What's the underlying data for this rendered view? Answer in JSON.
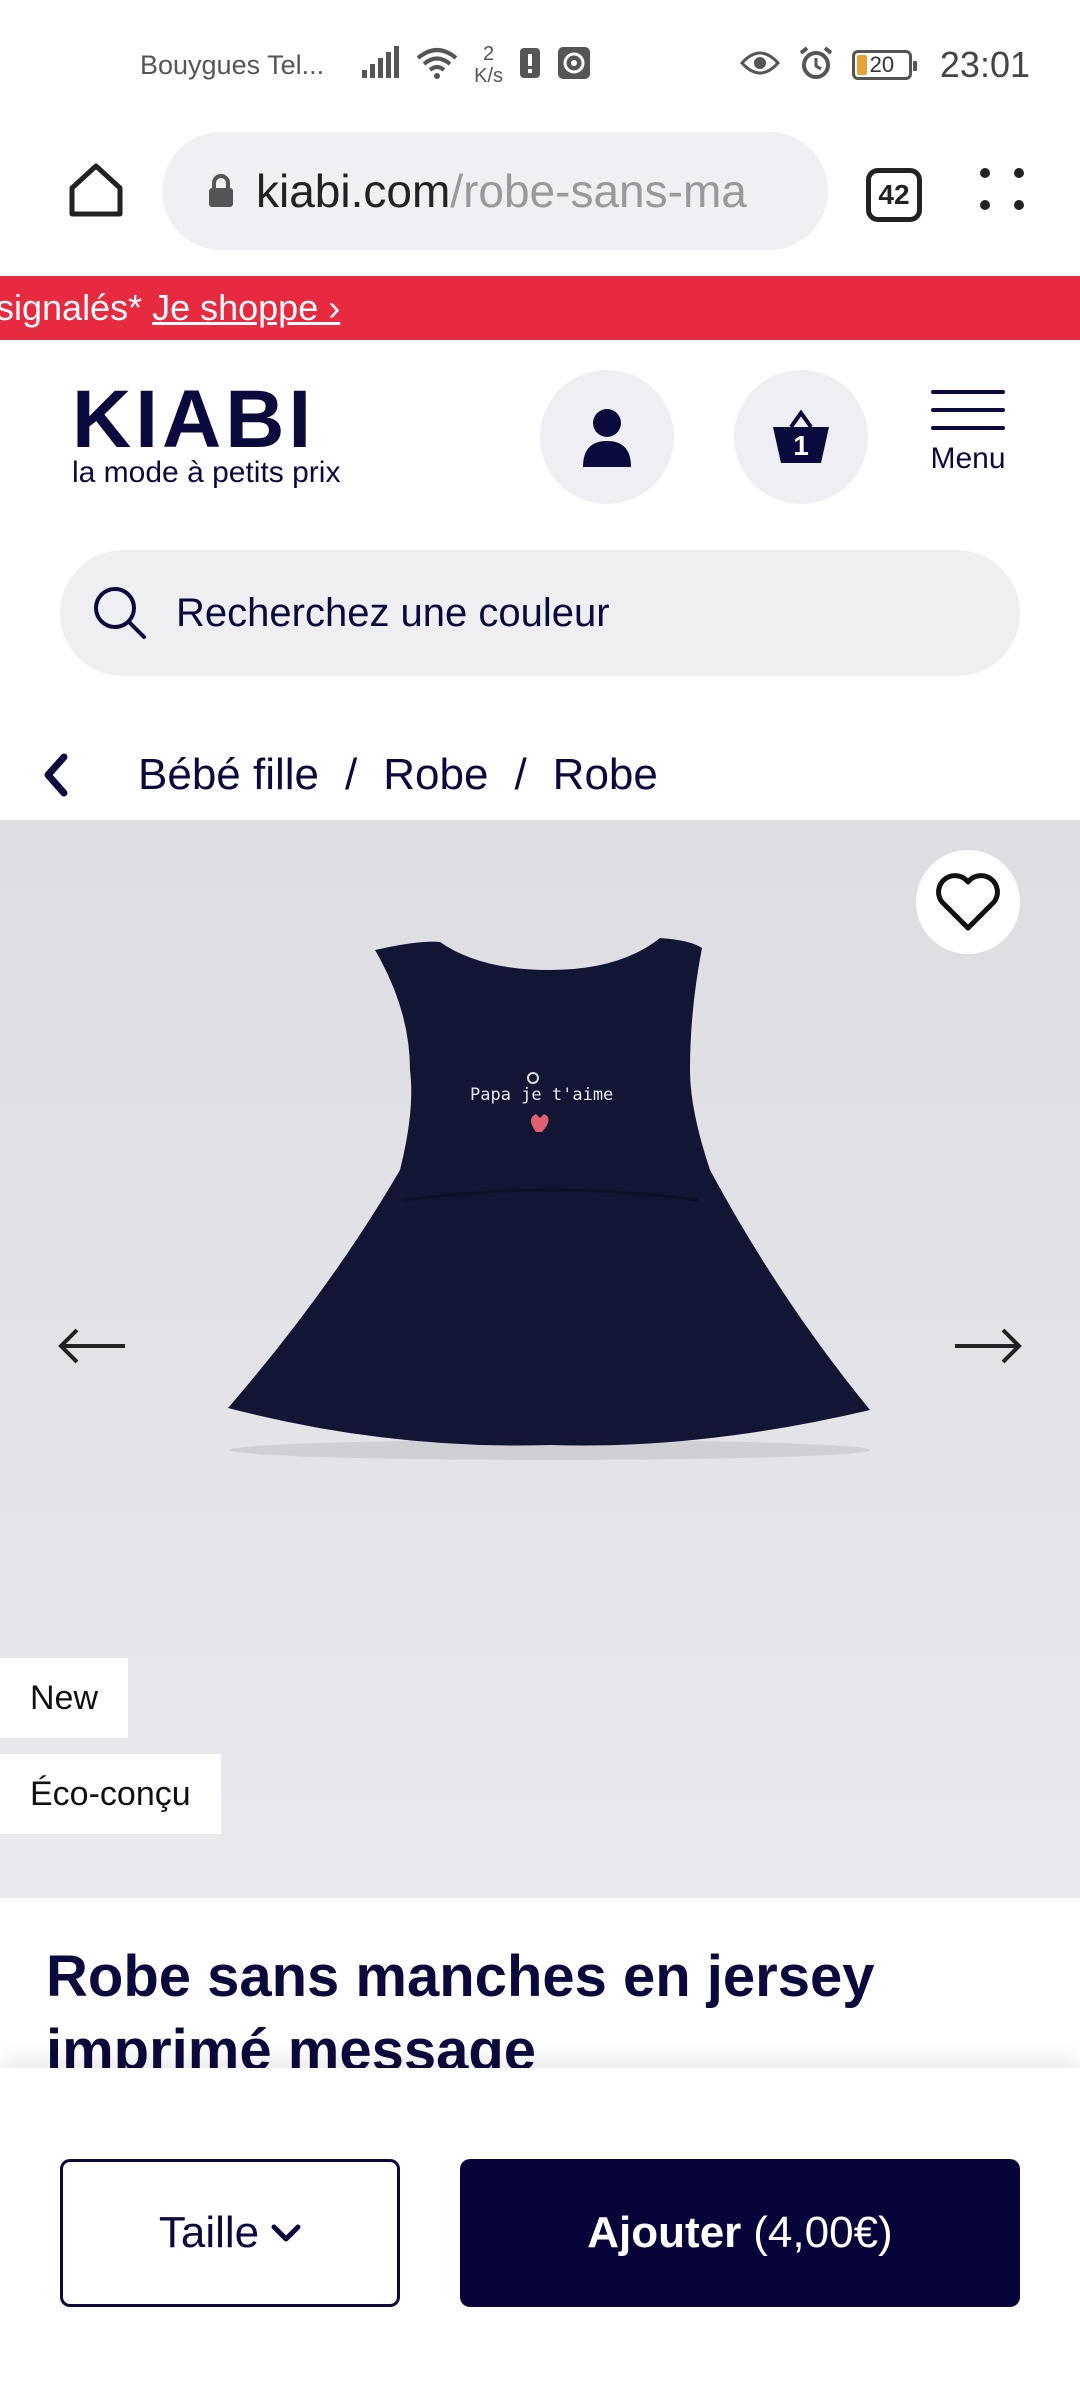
{
  "status_bar": {
    "carrier": "Bouygues Tel...",
    "net_speed_value": "2",
    "net_speed_unit": "K/s",
    "battery": "20",
    "time": "23:01",
    "icons": [
      "signal-icon",
      "wifi-icon",
      "alert-icon",
      "vpn-icon",
      "eye-icon",
      "alarm-icon",
      "battery-icon"
    ]
  },
  "browser": {
    "url_domain": "kiabi.com",
    "url_path": "/robe-sans-ma",
    "tab_count": "42"
  },
  "promo": {
    "text": "signalés*",
    "link": "Je shoppe ›",
    "color": "#e72a3f"
  },
  "header": {
    "logo": "KIABI",
    "tagline": "la mode à petits prix",
    "cart_count": "1",
    "menu_label": "Menu"
  },
  "search": {
    "placeholder": "Recherchez une couleur"
  },
  "breadcrumb": {
    "items": [
      "Bébé fille",
      "Robe",
      "Robe"
    ],
    "separator": "/"
  },
  "product": {
    "print_text": "Papa je t'aime",
    "badges": [
      "New",
      "Éco-conçu"
    ],
    "title": "Robe sans manches en jersey imprimé message"
  },
  "actions": {
    "size_label": "Taille",
    "add_label": "Ajouter",
    "add_price": "(4,00€)"
  },
  "colors": {
    "brand_navy": "#0b0a3c",
    "promo_red": "#e72a3f",
    "button_dark": "#07043a"
  }
}
